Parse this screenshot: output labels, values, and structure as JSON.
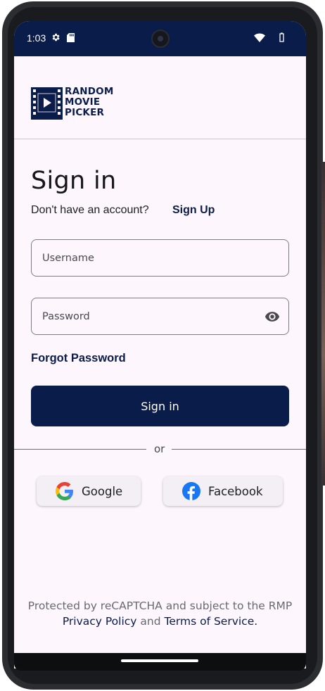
{
  "status_bar": {
    "time": "1:03",
    "icons": [
      "gear-icon",
      "sd-card-icon",
      "wifi-icon",
      "battery-icon"
    ],
    "background": "#0a1c4a"
  },
  "logo": {
    "line1": "RANDOM",
    "line2": "MOVIE",
    "line3": "PICKER"
  },
  "sign_in": {
    "title": "Sign in",
    "no_account_text": "Don't have an account?",
    "signup_link": "Sign Up",
    "username_placeholder": "Username",
    "password_placeholder": "Password",
    "forgot_password": "Forgot Password",
    "submit_label": "Sign in",
    "or_text": "or"
  },
  "social": {
    "google_label": "Google",
    "facebook_label": "Facebook"
  },
  "footer": {
    "text_before": "Protected by reCAPTCHA and subject to the RMP",
    "privacy_link": "Privacy Policy",
    "and_text": "and",
    "terms_link": "Terms of Service."
  },
  "colors": {
    "primary": "#0a1c4a",
    "screen_background": "#fdf6fd",
    "google_blue": "#4285F4",
    "google_red": "#EA4335",
    "google_yellow": "#FBBC05",
    "google_green": "#34A853",
    "facebook_blue": "#1877F2"
  }
}
